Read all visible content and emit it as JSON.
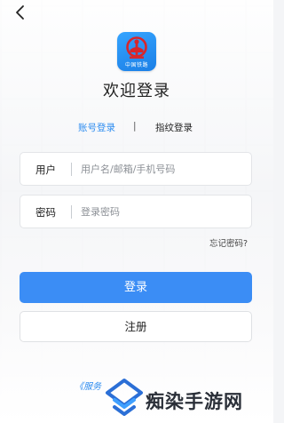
{
  "header": {
    "back_icon": "back-arrow-icon"
  },
  "app": {
    "logo_icon": "railway-logo-icon",
    "logo_caption": "中国铁路"
  },
  "page_title": "欢迎登录",
  "tabs": {
    "account_label": "账号登录",
    "separator": "|",
    "fingerprint_label": "指纹登录"
  },
  "username": {
    "label": "用户",
    "placeholder": "用户名/邮箱/手机号码",
    "value": ""
  },
  "password": {
    "label": "密码",
    "placeholder": "登录密码",
    "value": ""
  },
  "forgot_password": "忘记密码?",
  "login_button": "登录",
  "register_button": "注册",
  "service_link_partial": "《服务",
  "watermark": {
    "text": "痴染手游网",
    "icon": "watermark-logo-icon"
  },
  "colors": {
    "accent": "#3b8df5",
    "link": "#2d8cf0",
    "logo_bg": "#1b7fe6"
  }
}
